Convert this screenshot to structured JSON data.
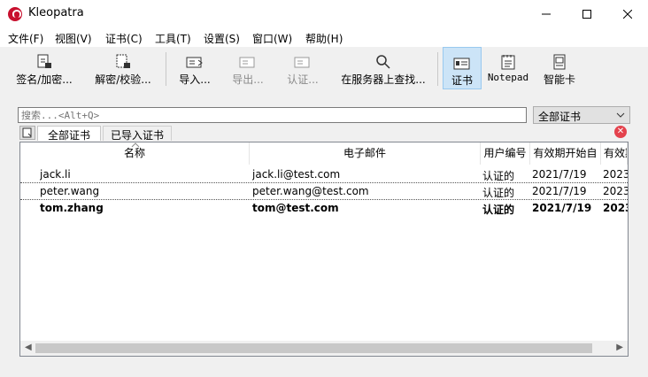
{
  "window": {
    "title": "Kleopatra"
  },
  "menu": [
    "文件(F)",
    "视图(V)",
    "证书(C)",
    "工具(T)",
    "设置(S)",
    "窗口(W)",
    "帮助(H)"
  ],
  "toolbar": {
    "sign": "签名/加密...",
    "decrypt": "解密/校验...",
    "import": "导入...",
    "export": "导出...",
    "certify": "认证...",
    "lookup": "在服务器上查找...",
    "certificates": "证书",
    "notepad": "Notepad",
    "smartcard": "智能卡"
  },
  "search": {
    "placeholder": "搜索...<Alt+Q>"
  },
  "filter": {
    "selected": "全部证书"
  },
  "tabs": [
    "全部证书",
    "已导入证书"
  ],
  "table": {
    "columns": [
      "名称",
      "电子邮件",
      "用户编号",
      "有效期开始自",
      "有效期"
    ],
    "rows": [
      {
        "name": "jack.li",
        "email": "jack.li@test.com",
        "uid": "认证的",
        "from": "2021/7/19",
        "until": "2023"
      },
      {
        "name": "peter.wang",
        "email": "peter.wang@test.com",
        "uid": "认证的",
        "from": "2021/7/19",
        "until": "2023"
      },
      {
        "name": "tom.zhang",
        "email": "tom@test.com",
        "uid": "认证的",
        "from": "2021/7/19",
        "until": "2023"
      }
    ]
  }
}
